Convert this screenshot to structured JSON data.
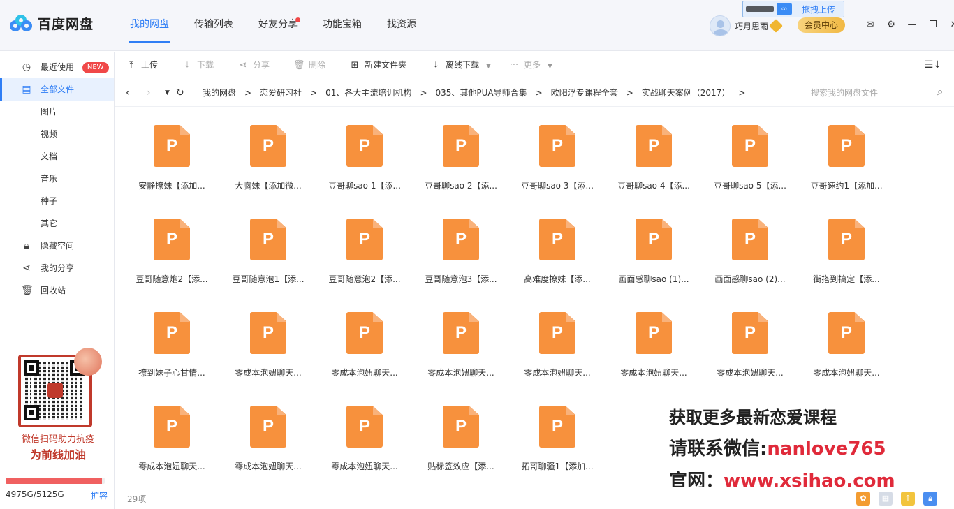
{
  "app": {
    "logo_text": "百度网盘",
    "nav": [
      {
        "label": "我的网盘",
        "active": true
      },
      {
        "label": "传输列表"
      },
      {
        "label": "好友分享",
        "dot": true
      },
      {
        "label": "功能宝箱"
      },
      {
        "label": "找资源"
      }
    ],
    "username": "巧月思雨",
    "member_button": "会员中心",
    "drag_upload": "拖拽上传"
  },
  "sidebar": {
    "items": [
      {
        "label": "最近使用",
        "icon": "clock-icon",
        "badge": "NEW"
      },
      {
        "label": "全部文件",
        "icon": "document-icon",
        "active": true
      },
      {
        "label": "图片"
      },
      {
        "label": "视频"
      },
      {
        "label": "文档"
      },
      {
        "label": "音乐"
      },
      {
        "label": "种子"
      },
      {
        "label": "其它"
      },
      {
        "label": "隐藏空间",
        "icon": "lock-icon"
      },
      {
        "label": "我的分享",
        "icon": "share-icon"
      },
      {
        "label": "回收站",
        "icon": "trash-icon"
      }
    ],
    "promo_line1": "微信扫码助力抗疫",
    "promo_line2": "为前线加油",
    "storage": "4975G/5125G",
    "storage_fraction": 0.971,
    "expand": "扩容"
  },
  "toolbar": {
    "upload": "上传",
    "download": "下载",
    "share": "分享",
    "delete": "删除",
    "new_folder": "新建文件夹",
    "offline_download": "离线下载",
    "more": "更多"
  },
  "breadcrumb": {
    "items": [
      "我的网盘",
      "恋爱研习社",
      "01、各大主流培训机构",
      "035、其他PUA导师合集",
      "欧阳浮专课程全套",
      "实战聊天案例（2017）"
    ],
    "search_placeholder": "搜索我的网盘文件"
  },
  "files": [
    "安静撩妹【添加...",
    "大胸妹【添加微...",
    "豆哥聊sao 1【添...",
    "豆哥聊sao 2【添...",
    "豆哥聊sao 3【添...",
    "豆哥聊sao 4【添...",
    "豆哥聊sao 5【添...",
    "豆哥速约1【添加...",
    "豆哥随意炮2【添...",
    "豆哥随意泡1【添...",
    "豆哥随意泡2【添...",
    "豆哥随意泡3【添...",
    "高难度撩妹【添...",
    "画面感聊sao (1)...",
    "画面感聊sao (2)...",
    "街搭到搞定【添...",
    "撩到妹子心甘情...",
    "零成本泡妞聊天...",
    "零成本泡妞聊天...",
    "零成本泡妞聊天...",
    "零成本泡妞聊天...",
    "零成本泡妞聊天...",
    "零成本泡妞聊天...",
    "零成本泡妞聊天...",
    "零成本泡妞聊天...",
    "零成本泡妞聊天...",
    "零成本泡妞聊天...",
    "贴标签效应【添...",
    "拓哥聊骚1【添加..."
  ],
  "status": {
    "count": "29项"
  },
  "watermark": {
    "line1": "获取更多最新恋爱课程",
    "line2_prefix": "请联系微信:",
    "line2_value": "nanlove765",
    "line3_prefix": "官网：",
    "line3_value": "www.xsjhao.com"
  }
}
